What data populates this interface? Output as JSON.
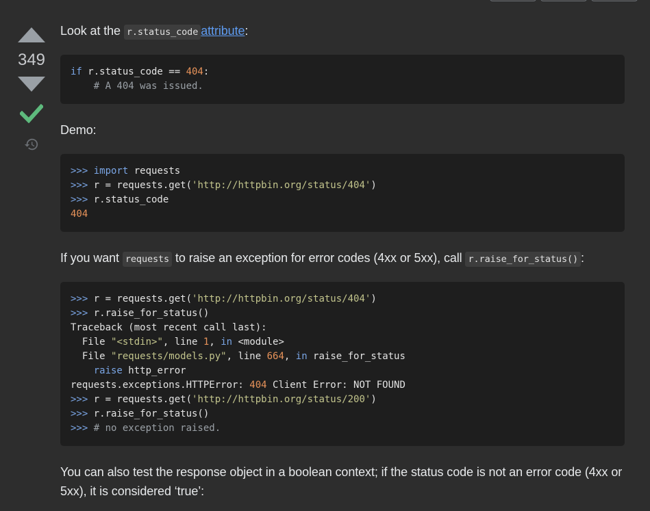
{
  "vote": {
    "count": "349"
  },
  "answer": {
    "p1": {
      "prefix": "Look at the ",
      "code": "r.status_code",
      "link": "attribute",
      "suffix": ":"
    },
    "code1": {
      "l1": {
        "kw": "if",
        "a": " r.status_code == ",
        "num": "404",
        "b": ":"
      },
      "l2": "    # A 404 was issued."
    },
    "p2": "Demo:",
    "code2": {
      "l1": {
        "prompt": ">>> ",
        "kw": "import",
        "rest": " requests"
      },
      "l2": {
        "prompt": ">>> ",
        "a": "r = requests.get(",
        "str": "'http://httpbin.org/status/404'",
        "b": ")"
      },
      "l3": {
        "prompt": ">>> ",
        "rest": "r.status_code"
      },
      "l4": "404"
    },
    "p3": {
      "a": "If you want ",
      "code1": "requests",
      "b": " to raise an exception for error codes (4xx or 5xx), call ",
      "code2": "r.raise_for_status()",
      "c": ":"
    },
    "code3": {
      "l1": {
        "prompt": ">>> ",
        "a": "r = requests.get(",
        "str": "'http://httpbin.org/status/404'",
        "b": ")"
      },
      "l2": {
        "prompt": ">>> ",
        "rest": "r.raise_for_status()"
      },
      "l3": "Traceback (most recent call last):",
      "l4": {
        "a": "  File ",
        "str": "\"<stdin>\"",
        "b": ", line ",
        "num": "1",
        "c": ", ",
        "kw": "in",
        "d": " <module>"
      },
      "l5": {
        "a": "  File ",
        "str": "\"requests/models.py\"",
        "b": ", line ",
        "num": "664",
        "c": ", ",
        "kw": "in",
        "d": " raise_for_status"
      },
      "l6": {
        "a": "    ",
        "kw": "raise",
        "b": " http_error"
      },
      "l7": {
        "a": "requests.exceptions.HTTPError: ",
        "num": "404",
        "b": " Client Error: NOT FOUND"
      },
      "l8": {
        "prompt": ">>> ",
        "a": "r = requests.get(",
        "str": "'http://httpbin.org/status/200'",
        "b": ")"
      },
      "l9": {
        "prompt": ">>> ",
        "rest": "r.raise_for_status()"
      },
      "l10": {
        "prompt": ">>> ",
        "cmt": "# no exception raised."
      }
    },
    "p4": "You can also test the response object in a boolean context; if the status code is not an error code (4xx or 5xx), it is considered ‘true’:"
  }
}
